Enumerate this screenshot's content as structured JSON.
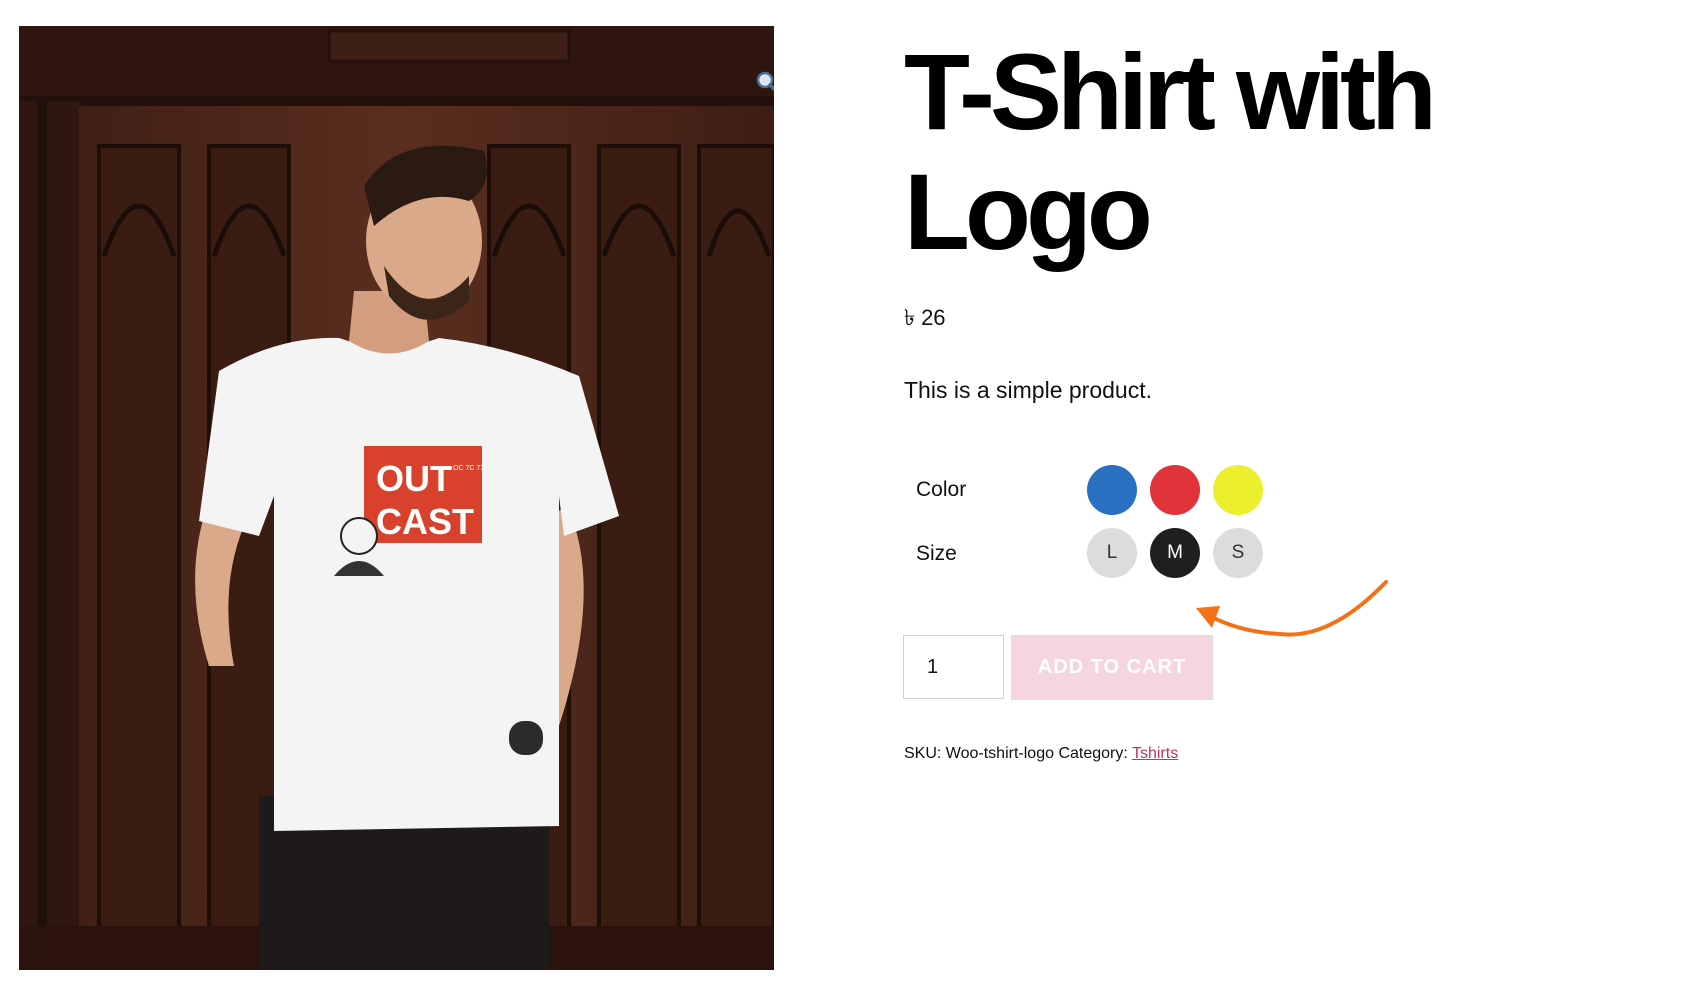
{
  "product": {
    "title_line1": "T-Shirt with",
    "title_line2": "Logo",
    "price": "৳ 26",
    "description": "This is a simple product."
  },
  "image": {
    "shirt_print_line1": "OUT",
    "shirt_print_line2": "CAST",
    "shirt_print_side": "OC 7C 77",
    "zoom_icon": "magnifier-icon"
  },
  "attributes": {
    "color": {
      "label": "Color",
      "swatches": [
        "#2a70c2",
        "#e0343a",
        "#ecef2c"
      ]
    },
    "size": {
      "label": "Size",
      "options": [
        "L",
        "M",
        "S"
      ],
      "selected": "M"
    }
  },
  "cart": {
    "quantity": "1",
    "add_label": "ADD TO CART"
  },
  "meta": {
    "sku_label": "SKU:",
    "sku": "Woo-tshirt-logo",
    "category_label": "Category:",
    "category": "Tshirts"
  },
  "colors": {
    "add_button_bg": "#f5d5de",
    "link": "#c7315f",
    "annotation_arrow": "#f47216"
  }
}
